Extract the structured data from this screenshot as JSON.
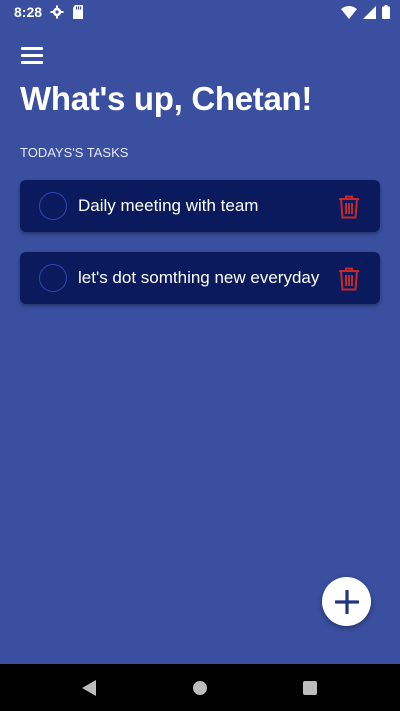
{
  "status_bar": {
    "time": "8:28",
    "icons_left": [
      "gear-icon",
      "sd-card-icon"
    ],
    "icons_right": [
      "wifi-icon",
      "signal-icon",
      "battery-icon"
    ]
  },
  "header": {
    "menu_icon": "hamburger-menu-icon",
    "greeting": "What's up, Chetan!"
  },
  "section": {
    "title": "TODAYS'S TASKS"
  },
  "tasks": [
    {
      "label": "Daily meeting with team",
      "completed": false
    },
    {
      "label": "let's dot somthing new everyday",
      "completed": false
    }
  ],
  "fab": {
    "icon": "plus-icon"
  },
  "nav_bar": {
    "icons": [
      "back-icon",
      "home-icon",
      "recents-icon"
    ]
  },
  "colors": {
    "background": "#3a4fa0",
    "task_card": "#0a1a5c",
    "delete": "#c62828",
    "check_border": "#2e47b7",
    "fab": "#ffffff"
  }
}
